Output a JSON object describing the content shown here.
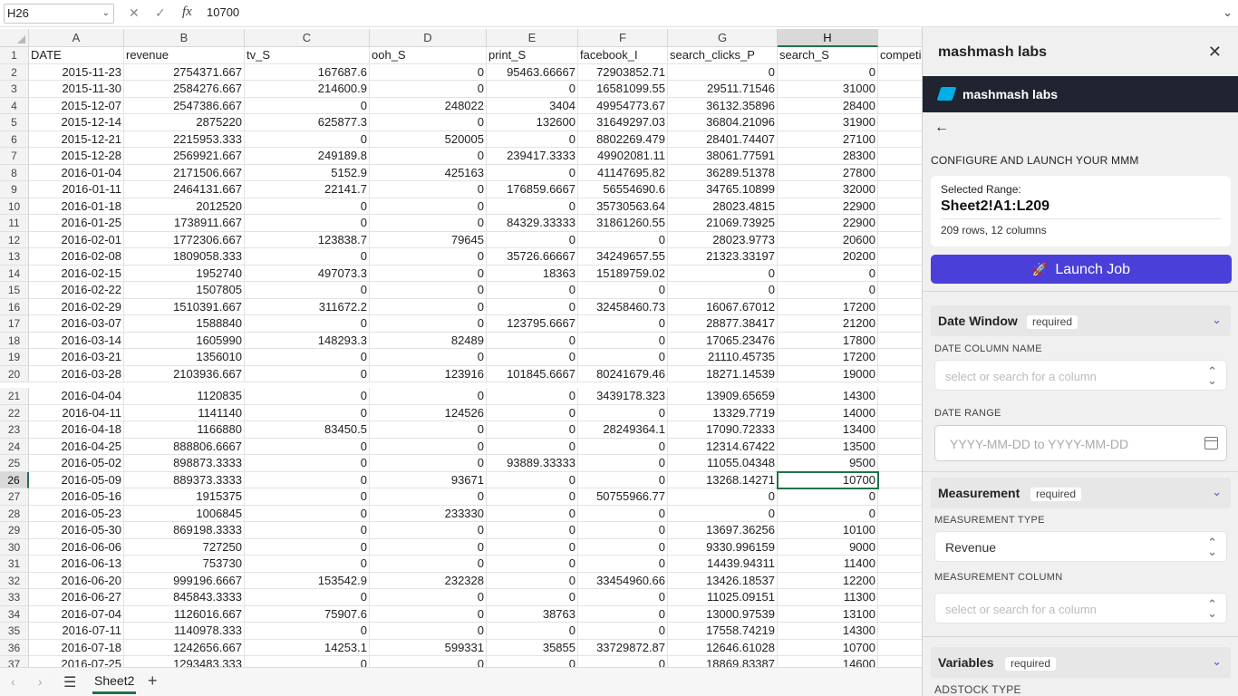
{
  "formula_bar": {
    "name_box": "H26",
    "cancel_icon": "✕",
    "enter_icon": "✓",
    "fx_label": "fx",
    "value": "10700"
  },
  "columns": [
    {
      "letter": "A",
      "selected": false
    },
    {
      "letter": "B",
      "selected": false
    },
    {
      "letter": "C",
      "selected": false
    },
    {
      "letter": "D",
      "selected": false
    },
    {
      "letter": "E",
      "selected": false
    },
    {
      "letter": "F",
      "selected": false
    },
    {
      "letter": "G",
      "selected": false
    },
    {
      "letter": "H",
      "selected": true
    }
  ],
  "active_cell": "H26",
  "rows": [
    {
      "n": "1",
      "cells": [
        "DATE",
        "revenue",
        "tv_S",
        "ooh_S",
        "print_S",
        "facebook_I",
        "search_clicks_P",
        "search_S",
        "competi"
      ]
    },
    {
      "n": "2",
      "cells": [
        "2015-11-23",
        "2754371.667",
        "167687.6",
        "0",
        "95463.66667",
        "72903852.71",
        "0",
        "0",
        ""
      ]
    },
    {
      "n": "3",
      "cells": [
        "2015-11-30",
        "2584276.667",
        "214600.9",
        "0",
        "0",
        "16581099.55",
        "29511.71546",
        "31000",
        ""
      ]
    },
    {
      "n": "4",
      "cells": [
        "2015-12-07",
        "2547386.667",
        "0",
        "248022",
        "3404",
        "49954773.67",
        "36132.35896",
        "28400",
        ""
      ]
    },
    {
      "n": "5",
      "cells": [
        "2015-12-14",
        "2875220",
        "625877.3",
        "0",
        "132600",
        "31649297.03",
        "36804.21096",
        "31900",
        ""
      ]
    },
    {
      "n": "6",
      "cells": [
        "2015-12-21",
        "2215953.333",
        "0",
        "520005",
        "0",
        "8802269.479",
        "28401.74407",
        "27100",
        ""
      ]
    },
    {
      "n": "7",
      "cells": [
        "2015-12-28",
        "2569921.667",
        "249189.8",
        "0",
        "239417.3333",
        "49902081.11",
        "38061.77591",
        "28300",
        ""
      ]
    },
    {
      "n": "8",
      "cells": [
        "2016-01-04",
        "2171506.667",
        "5152.9",
        "425163",
        "0",
        "41147695.82",
        "36289.51378",
        "27800",
        ""
      ]
    },
    {
      "n": "9",
      "cells": [
        "2016-01-11",
        "2464131.667",
        "22141.7",
        "0",
        "176859.6667",
        "56554690.6",
        "34765.10899",
        "32000",
        ""
      ]
    },
    {
      "n": "10",
      "cells": [
        "2016-01-18",
        "2012520",
        "0",
        "0",
        "0",
        "35730563.64",
        "28023.4815",
        "22900",
        ""
      ]
    },
    {
      "n": "11",
      "cells": [
        "2016-01-25",
        "1738911.667",
        "0",
        "0",
        "84329.33333",
        "31861260.55",
        "21069.73925",
        "22900",
        ""
      ]
    },
    {
      "n": "12",
      "cells": [
        "2016-02-01",
        "1772306.667",
        "123838.7",
        "79645",
        "0",
        "0",
        "28023.9773",
        "20600",
        ""
      ]
    },
    {
      "n": "13",
      "cells": [
        "2016-02-08",
        "1809058.333",
        "0",
        "0",
        "35726.66667",
        "34249657.55",
        "21323.33197",
        "20200",
        ""
      ]
    },
    {
      "n": "14",
      "cells": [
        "2016-02-15",
        "1952740",
        "497073.3",
        "0",
        "18363",
        "15189759.02",
        "0",
        "0",
        ""
      ]
    },
    {
      "n": "15",
      "cells": [
        "2016-02-22",
        "1507805",
        "0",
        "0",
        "0",
        "0",
        "0",
        "0",
        ""
      ]
    },
    {
      "n": "16",
      "cells": [
        "2016-02-29",
        "1510391.667",
        "311672.2",
        "0",
        "0",
        "32458460.73",
        "16067.67012",
        "17200",
        ""
      ]
    },
    {
      "n": "17",
      "cells": [
        "2016-03-07",
        "1588840",
        "0",
        "0",
        "123795.6667",
        "0",
        "28877.38417",
        "21200",
        ""
      ]
    },
    {
      "n": "18",
      "cells": [
        "2016-03-14",
        "1605990",
        "148293.3",
        "82489",
        "0",
        "0",
        "17065.23476",
        "17800",
        ""
      ]
    },
    {
      "n": "19",
      "cells": [
        "2016-03-21",
        "1356010",
        "0",
        "0",
        "0",
        "0",
        "21110.45735",
        "17200",
        ""
      ]
    },
    {
      "n": "20",
      "cells": [
        "2016-03-28",
        "2103936.667",
        "0",
        "123916",
        "101845.6667",
        "80241679.46",
        "18271.14539",
        "19000",
        ""
      ]
    },
    {
      "n": "21",
      "cells": [
        "2016-04-04",
        "1120835",
        "0",
        "0",
        "0",
        "3439178.323",
        "13909.65659",
        "14300",
        ""
      ]
    },
    {
      "n": "22",
      "cells": [
        "2016-04-11",
        "1141140",
        "0",
        "124526",
        "0",
        "0",
        "13329.7719",
        "14000",
        ""
      ]
    },
    {
      "n": "23",
      "cells": [
        "2016-04-18",
        "1166880",
        "83450.5",
        "0",
        "0",
        "28249364.1",
        "17090.72333",
        "13400",
        ""
      ]
    },
    {
      "n": "24",
      "cells": [
        "2016-04-25",
        "888806.6667",
        "0",
        "0",
        "0",
        "0",
        "12314.67422",
        "13500",
        ""
      ]
    },
    {
      "n": "25",
      "cells": [
        "2016-05-02",
        "898873.3333",
        "0",
        "0",
        "93889.33333",
        "0",
        "11055.04348",
        "9500",
        ""
      ]
    },
    {
      "n": "26",
      "cells": [
        "2016-05-09",
        "889373.3333",
        "0",
        "93671",
        "0",
        "0",
        "13268.14271",
        "10700",
        ""
      ]
    },
    {
      "n": "27",
      "cells": [
        "2016-05-16",
        "1915375",
        "0",
        "0",
        "0",
        "50755966.77",
        "0",
        "0",
        ""
      ]
    },
    {
      "n": "28",
      "cells": [
        "2016-05-23",
        "1006845",
        "0",
        "233330",
        "0",
        "0",
        "0",
        "0",
        ""
      ]
    },
    {
      "n": "29",
      "cells": [
        "2016-05-30",
        "869198.3333",
        "0",
        "0",
        "0",
        "0",
        "13697.36256",
        "10100",
        ""
      ]
    },
    {
      "n": "30",
      "cells": [
        "2016-06-06",
        "727250",
        "0",
        "0",
        "0",
        "0",
        "9330.996159",
        "9000",
        ""
      ]
    },
    {
      "n": "31",
      "cells": [
        "2016-06-13",
        "753730",
        "0",
        "0",
        "0",
        "0",
        "14439.94311",
        "11400",
        ""
      ]
    },
    {
      "n": "32",
      "cells": [
        "2016-06-20",
        "999196.6667",
        "153542.9",
        "232328",
        "0",
        "33454960.66",
        "13426.18537",
        "12200",
        ""
      ]
    },
    {
      "n": "33",
      "cells": [
        "2016-06-27",
        "845843.3333",
        "0",
        "0",
        "0",
        "0",
        "11025.09151",
        "11300",
        ""
      ]
    },
    {
      "n": "34",
      "cells": [
        "2016-07-04",
        "1126016.667",
        "75907.6",
        "0",
        "38763",
        "0",
        "13000.97539",
        "13100",
        ""
      ]
    },
    {
      "n": "35",
      "cells": [
        "2016-07-11",
        "1140978.333",
        "0",
        "0",
        "0",
        "0",
        "17558.74219",
        "14300",
        ""
      ]
    },
    {
      "n": "36",
      "cells": [
        "2016-07-18",
        "1242656.667",
        "14253.1",
        "599331",
        "35855",
        "33729872.87",
        "12646.61028",
        "10700",
        ""
      ]
    },
    {
      "n": "37",
      "cells": [
        "2016-07-25",
        "1293483.333",
        "0",
        "0",
        "0",
        "0",
        "18869.83387",
        "14600",
        ""
      ]
    }
  ],
  "sheet_tabs": {
    "prev_icon": "‹",
    "next_icon": "›",
    "menu_icon": "☰",
    "active_sheet": "Sheet2",
    "add_icon": "+"
  },
  "panel": {
    "title": "mashmash labs",
    "close_icon": "✕",
    "brand_name": "mashmash labs",
    "back_icon": "←",
    "section_title": "CONFIGURE AND LAUNCH YOUR MMM",
    "selected_range_label": "Selected Range:",
    "selected_range_value": "Sheet2!A1:L209",
    "selected_range_info": "209 rows, 12 columns",
    "launch_icon": "🚀",
    "launch_label": "Launch Job",
    "date_window": {
      "title": "Date Window",
      "tag": "required",
      "date_column_label": "DATE COLUMN NAME",
      "date_column_placeholder": "select or search for a column",
      "date_range_label": "DATE RANGE",
      "date_range_placeholder": "YYYY-MM-DD to YYYY-MM-DD"
    },
    "measurement": {
      "title": "Measurement",
      "tag": "required",
      "type_label": "MEASUREMENT TYPE",
      "type_value": "Revenue",
      "column_label": "MEASUREMENT COLUMN",
      "column_placeholder": "select or search for a column"
    },
    "variables": {
      "title": "Variables",
      "tag": "required",
      "adstock_label": "ADSTOCK TYPE"
    },
    "accent_color": "#4a3fd8",
    "brand_bar_color": "#1f2430",
    "selection_color": "#217346"
  }
}
